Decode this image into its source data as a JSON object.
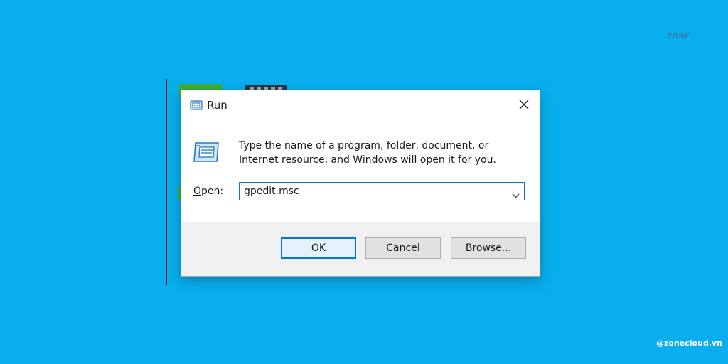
{
  "watermark": {
    "top_text": "ZONE",
    "bottom_text": "@zonecloud.vn"
  },
  "dialog": {
    "title": "Run",
    "description": "Type the name of a program, folder, document, or Internet resource, and Windows will open it for you.",
    "open_label_underlined": "O",
    "open_label_rest": "pen:",
    "open_value": "gpedit.msc",
    "buttons": {
      "ok": "OK",
      "cancel": "Cancel",
      "browse_underlined": "B",
      "browse_rest": "rowse..."
    },
    "icons": {
      "title": "run-icon",
      "main": "run-icon",
      "close": "close-icon",
      "dropdown": "chevron-down-icon"
    },
    "colors": {
      "desktop": "#08aeee",
      "accent": "#0078d7",
      "footer": "#f0f0f0"
    }
  }
}
